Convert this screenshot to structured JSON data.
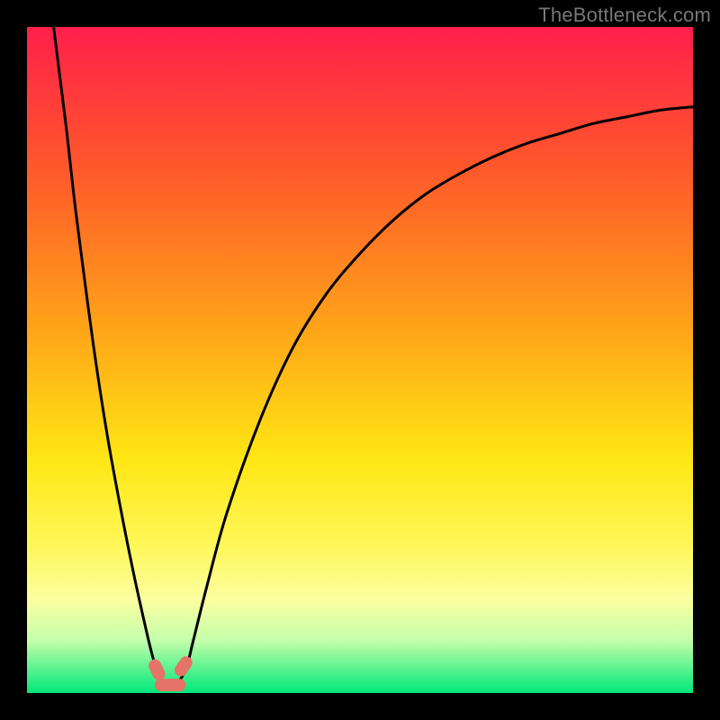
{
  "watermark": "TheBottleneck.com",
  "chart_data": {
    "type": "line",
    "title": "",
    "xlabel": "",
    "ylabel": "",
    "xlim": [
      0,
      100
    ],
    "ylim": [
      0,
      100
    ],
    "grid": false,
    "legend": false,
    "background_gradient": {
      "stops": [
        {
          "pos": 0.0,
          "color": "#ff1f4b"
        },
        {
          "pos": 0.22,
          "color": "#ff5a2a"
        },
        {
          "pos": 0.45,
          "color": "#ffa318"
        },
        {
          "pos": 0.65,
          "color": "#ffe714"
        },
        {
          "pos": 0.78,
          "color": "#fff75a"
        },
        {
          "pos": 0.86,
          "color": "#fbffa1"
        },
        {
          "pos": 0.92,
          "color": "#c6ffab"
        },
        {
          "pos": 1.0,
          "color": "#00e87a"
        }
      ]
    },
    "series": [
      {
        "name": "bottleneck-curve",
        "x": [
          4,
          5,
          6,
          7,
          8,
          10,
          12,
          14,
          16,
          18,
          19,
          20,
          21,
          22,
          23,
          24,
          25,
          27,
          30,
          35,
          40,
          45,
          50,
          55,
          60,
          65,
          70,
          75,
          80,
          85,
          90,
          95,
          100
        ],
        "y": [
          100,
          92,
          84,
          75,
          67,
          52,
          39,
          28,
          18,
          9,
          5,
          2,
          1,
          1,
          2,
          4,
          8,
          16,
          27,
          41,
          52,
          60,
          66,
          71,
          75,
          78,
          80.5,
          82.5,
          84,
          85.5,
          86.5,
          87.5,
          88
        ]
      }
    ],
    "markers": [
      {
        "name": "trough-left",
        "x": 19.5,
        "y": 3.5,
        "color": "#e57368"
      },
      {
        "name": "trough-right",
        "x": 23.5,
        "y": 4.0,
        "color": "#e57368"
      },
      {
        "name": "trough-mid-a",
        "x": 20.8,
        "y": 1.2,
        "color": "#e57368"
      },
      {
        "name": "trough-mid-b",
        "x": 22.2,
        "y": 1.2,
        "color": "#e57368"
      }
    ]
  }
}
